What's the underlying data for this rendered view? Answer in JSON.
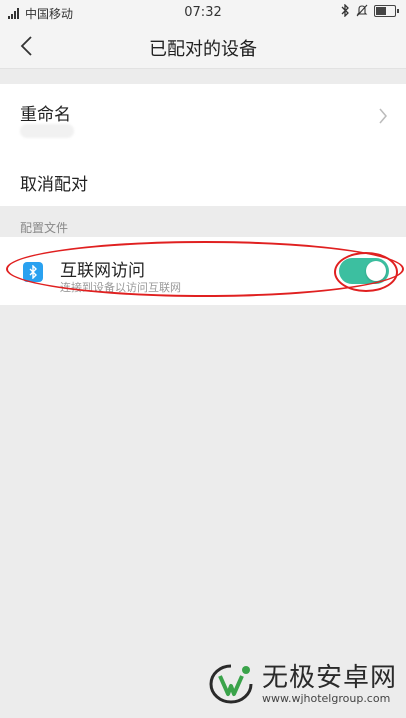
{
  "status_bar": {
    "carrier": "中国移动",
    "time": "07:32",
    "battery_level": 0.55
  },
  "nav": {
    "title": "已配对的设备"
  },
  "device": {
    "rename_label": "重命名",
    "unpair_label": "取消配对"
  },
  "profiles": {
    "section_title": "配置文件",
    "items": [
      {
        "title": "互联网访问",
        "subtitle": "连接到设备以访问互联网",
        "enabled": true
      }
    ]
  },
  "watermark": {
    "name": "无极安卓网",
    "url": "www.wjhotelgroup.com"
  },
  "colors": {
    "toggle_on": "#3cbfa0",
    "bluetooth_icon": "#2aa1f0",
    "annotation": "#e02020"
  }
}
